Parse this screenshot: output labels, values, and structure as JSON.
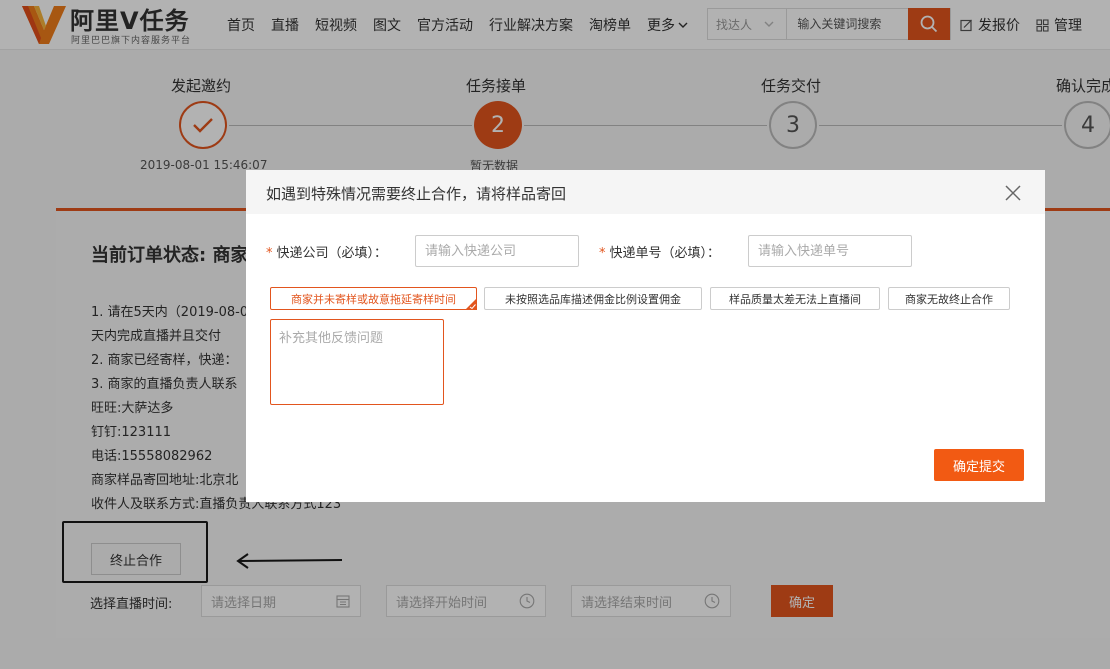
{
  "header": {
    "logo_title": "阿里V任务",
    "logo_subtitle": "阿里巴巴旗下内容服务平台",
    "nav": [
      "首页",
      "直播",
      "短视频",
      "图文",
      "官方活动",
      "行业解决方案",
      "淘榜单"
    ],
    "nav_more": "更多",
    "search": {
      "type_label": "找达人",
      "placeholder": "输入关键词搜索"
    },
    "publish_link": "发报价",
    "manage_link": "管理"
  },
  "steps": [
    {
      "title": "发起邀约",
      "state": "done",
      "sub": "2019-08-01 15:46:07"
    },
    {
      "title": "任务接单",
      "state": "active",
      "number": "2",
      "sub": "暂无数据"
    },
    {
      "title": "任务交付",
      "state": "pending",
      "number": "3"
    },
    {
      "title": "确认完成",
      "state": "pending",
      "number": "4"
    }
  ],
  "order": {
    "status_title": "当前订单状态: 商家",
    "lines": [
      "1. 请在5天内（2019-08-0",
      "天内完成直播并且交付",
      "2. 商家已经寄样，快递：",
      "3. 商家的直播负责人联系",
      "旺旺:大萨达多",
      "钉钉:123111",
      "电话:15558082962",
      "商家样品寄回地址:北京北",
      "收件人及联系方式:直播负责人联系方式123"
    ],
    "terminate_button": "终止合作",
    "time_label": "选择直播时间:",
    "date_placeholder": "请选择日期",
    "start_placeholder": "请选择开始时间",
    "end_placeholder": "请选择结束时间",
    "confirm_button": "确定"
  },
  "modal": {
    "title": "如遇到特殊情况需要终止合作，请将样品寄回",
    "company_label": "快递公司（必填）：",
    "company_placeholder": "请输入快递公司",
    "number_label": "快递单号（必填）：",
    "number_placeholder": "请输入快递单号",
    "reasons": [
      "商家并未寄样或故意拖延寄样时间",
      "未按照选品库描述佣金比例设置佣金",
      "样品质量太差无法上直播间",
      "商家无故终止合作"
    ],
    "selected_reason": "商家并未寄样或故意拖延寄样时间",
    "feedback_placeholder": "补充其他反馈问题",
    "submit_button": "确定提交"
  },
  "colors": {
    "accent": "#e2551e",
    "submit": "#f25a13"
  }
}
